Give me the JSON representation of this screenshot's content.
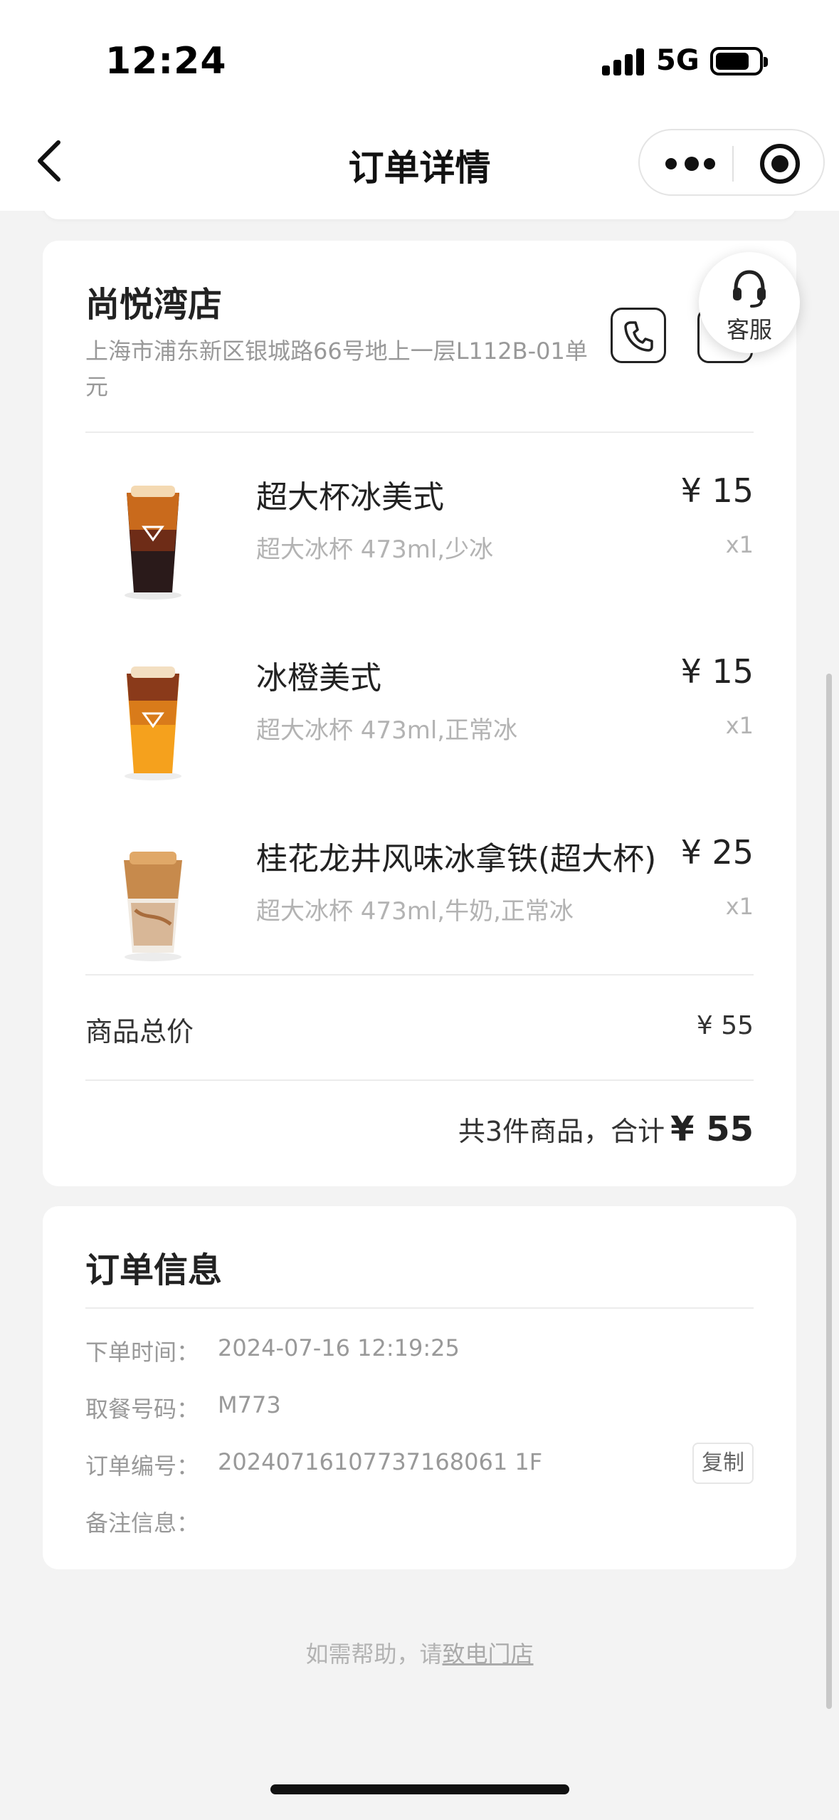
{
  "status_bar": {
    "time": "12:24",
    "network": "5G"
  },
  "nav": {
    "title": "订单详情"
  },
  "store": {
    "name": "尚悦湾店",
    "address": "上海市浦东新区银城路66号地上一层L112B-01单元",
    "service_label": "客服"
  },
  "items": [
    {
      "name": "超大杯冰美式",
      "spec": "超大冰杯 473ml,少冰",
      "price": "¥ 15",
      "qty": "x1"
    },
    {
      "name": "冰橙美式",
      "spec": "超大冰杯 473ml,正常冰",
      "price": "¥ 15",
      "qty": "x1"
    },
    {
      "name": "桂花龙井风味冰拿铁(超大杯)",
      "spec": "超大冰杯 473ml,牛奶,正常冰",
      "price": "¥ 25",
      "qty": "x1"
    }
  ],
  "summary": {
    "subtotal_label": "商品总价",
    "subtotal_value": "¥ 55",
    "total_prefix": "共3件商品，合计",
    "total_amount": "¥ 55"
  },
  "order_info": {
    "title": "订单信息",
    "rows": [
      {
        "key": "下单时间：",
        "value": "2024-07-16 12:19:25"
      },
      {
        "key": "取餐号码：",
        "value": "M773"
      },
      {
        "key": "订单编号：",
        "value": "20240716107737168061 1F"
      },
      {
        "key": "备注信息：",
        "value": ""
      }
    ],
    "copy_label": "复制"
  },
  "help": {
    "prefix": "如需帮助，请",
    "link": "致电门店"
  },
  "colors": {
    "background": "#f3f3f3",
    "card": "#ffffff",
    "text": "#222222",
    "muted": "#999999"
  }
}
